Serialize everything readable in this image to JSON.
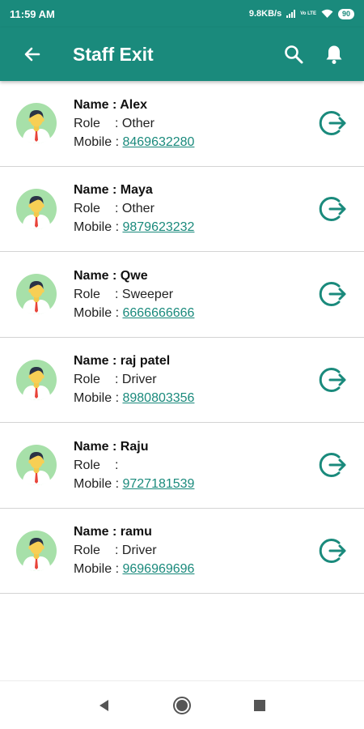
{
  "status_bar": {
    "time": "11:59 AM",
    "network_speed": "9.8KB/s",
    "volte": "Vo LTE",
    "battery": "90"
  },
  "app_bar": {
    "title": "Staff Exit",
    "back_icon": "arrow-left-icon",
    "search_icon": "search-icon",
    "bell_icon": "bell-icon"
  },
  "labels": {
    "name": "Name : ",
    "role": "Role",
    "role_sep": ": ",
    "mobile": "Mobile : "
  },
  "staff": [
    {
      "name": "Alex",
      "role": "Other",
      "mobile": "8469632280"
    },
    {
      "name": "Maya",
      "role": "Other",
      "mobile": "9879623232"
    },
    {
      "name": "Qwe",
      "role": "Sweeper",
      "mobile": "6666666666"
    },
    {
      "name": "raj patel",
      "role": "Driver",
      "mobile": "8980803356"
    },
    {
      "name": "Raju",
      "role": "",
      "mobile": "9727181539"
    },
    {
      "name": "ramu",
      "role": "Driver",
      "mobile": "9696969696"
    }
  ],
  "colors": {
    "primary": "#1a8a7c",
    "avatar_bg": "#a7e0a9",
    "tie": "#e8443a"
  },
  "nav_bar": {
    "back_icon": "triangle-back-icon",
    "home_icon": "circle-home-icon",
    "recents_icon": "square-recents-icon"
  }
}
